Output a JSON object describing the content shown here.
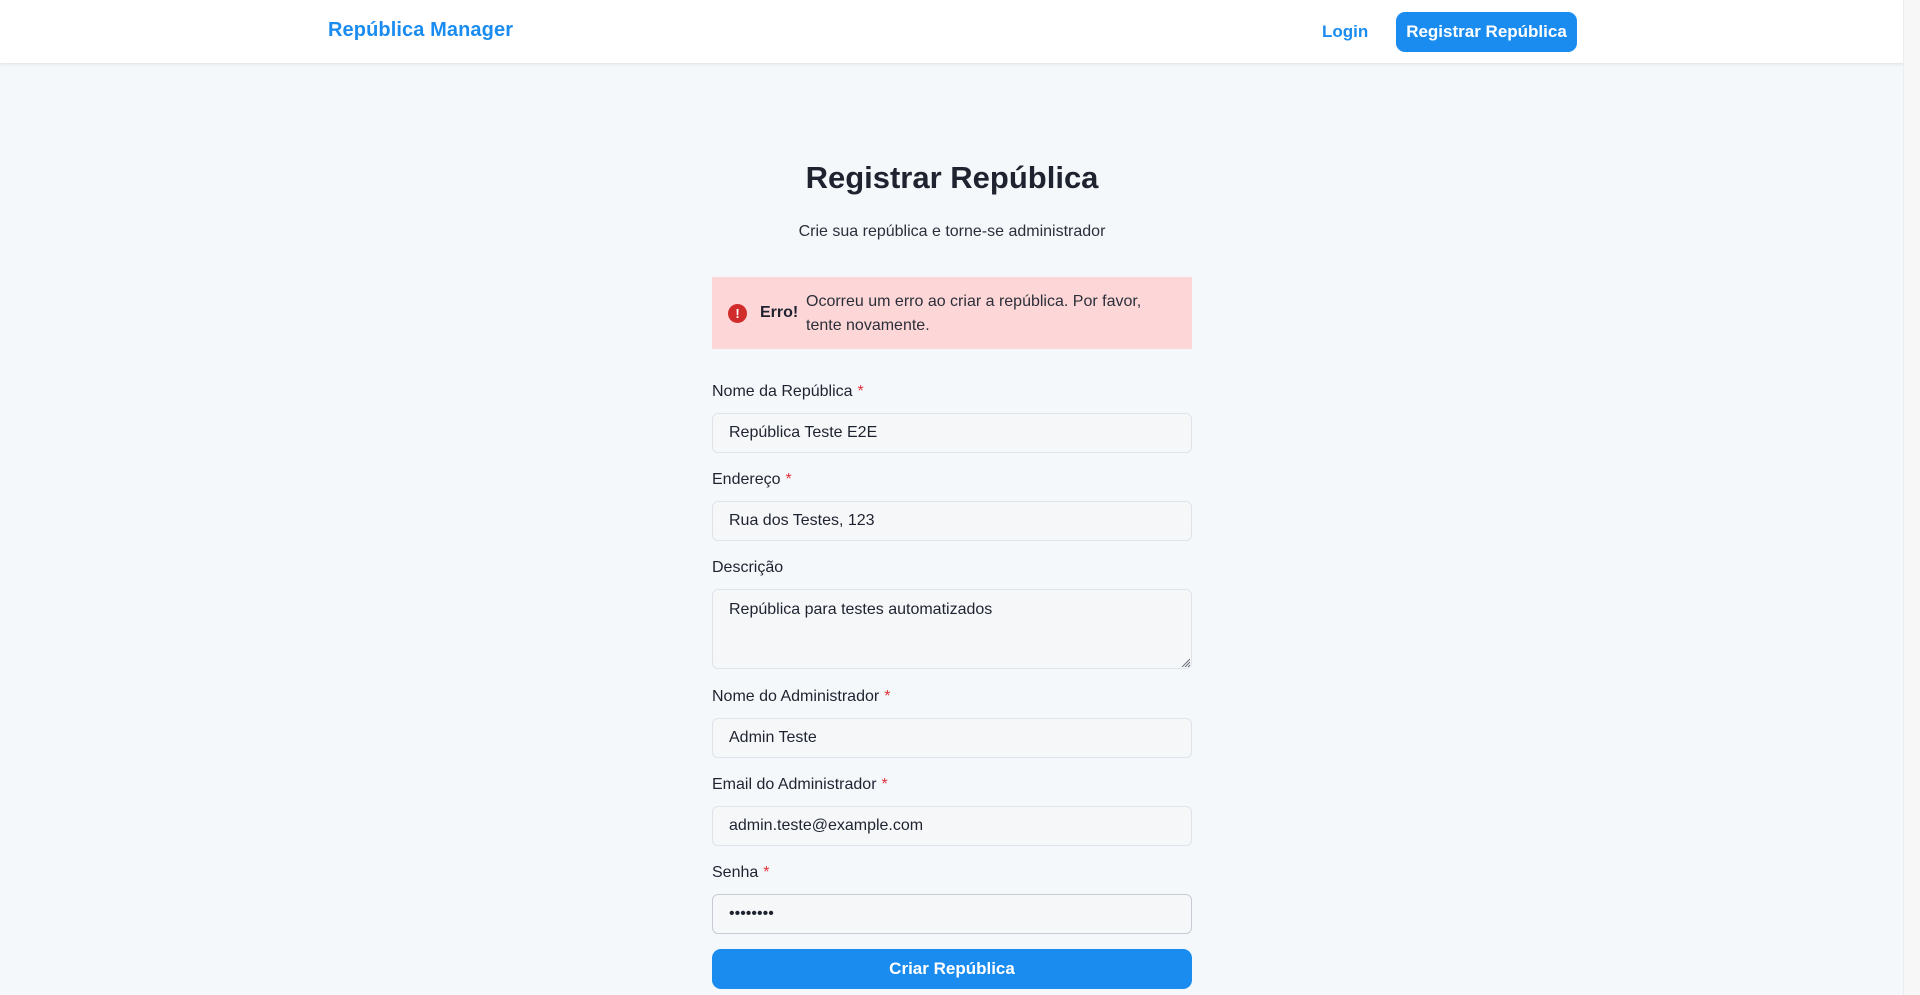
{
  "header": {
    "brand": "República Manager",
    "login_label": "Login",
    "register_label": "Registrar República"
  },
  "page": {
    "title": "Registrar República",
    "subtitle": "Crie sua república e torne-se administrador"
  },
  "alert": {
    "icon": "!",
    "title": "Erro!",
    "message": "Ocorreu um erro ao criar a república. Por favor, tente novamente."
  },
  "form": {
    "required_marker": "*",
    "republic_name": {
      "label": "Nome da República",
      "value": "República Teste E2E"
    },
    "address": {
      "label": "Endereço",
      "value": "Rua dos Testes, 123"
    },
    "description": {
      "label": "Descrição",
      "value": "República para testes automatizados"
    },
    "admin_name": {
      "label": "Nome do Administrador",
      "value": "Admin Teste"
    },
    "admin_email": {
      "label": "Email do Administrador",
      "value": "admin.teste@example.com"
    },
    "password": {
      "label": "Senha",
      "value": "••••••••"
    },
    "submit_label": "Criar República"
  },
  "colors": {
    "accent": "#1a8cf0",
    "error_bg": "#fdd7d7",
    "error_icon": "#d12c2c",
    "required": "#e0313a"
  }
}
